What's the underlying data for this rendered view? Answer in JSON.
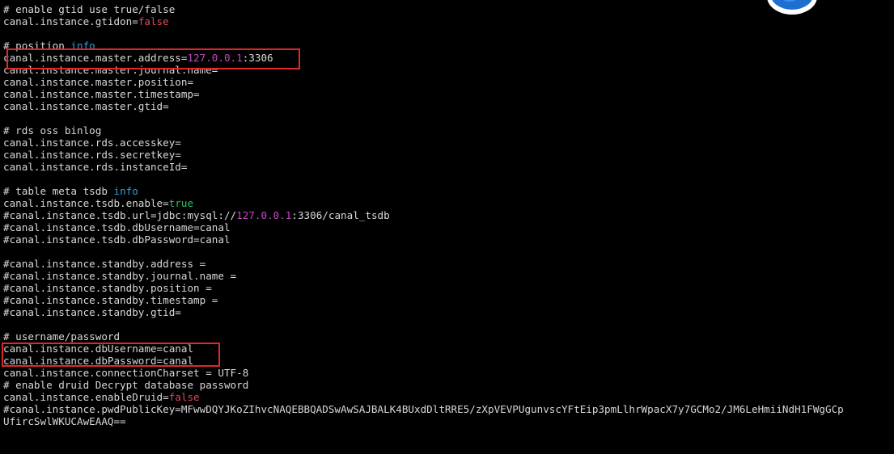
{
  "terminal": {
    "lines": [
      {
        "segments": [
          {
            "text": "# enable gtid use true/false",
            "style": "comment"
          }
        ]
      },
      {
        "segments": [
          {
            "text": "canal.instance.gtidon=",
            "style": "plain"
          },
          {
            "text": "false",
            "style": "bool-false"
          }
        ]
      },
      {
        "segments": [
          {
            "text": "",
            "style": "plain"
          }
        ]
      },
      {
        "segments": [
          {
            "text": "# position ",
            "style": "comment"
          },
          {
            "text": "info",
            "style": "info"
          }
        ]
      },
      {
        "segments": [
          {
            "text": "canal.instance.master.address=",
            "style": "plain"
          },
          {
            "text": "127.0.0.1",
            "style": "ip"
          },
          {
            "text": ":3306",
            "style": "plain"
          }
        ]
      },
      {
        "segments": [
          {
            "text": "canal.instance.master.journal.name=",
            "style": "plain"
          }
        ]
      },
      {
        "segments": [
          {
            "text": "canal.instance.master.position=",
            "style": "plain"
          }
        ]
      },
      {
        "segments": [
          {
            "text": "canal.instance.master.timestamp=",
            "style": "plain"
          }
        ]
      },
      {
        "segments": [
          {
            "text": "canal.instance.master.gtid=",
            "style": "plain"
          }
        ]
      },
      {
        "segments": [
          {
            "text": "",
            "style": "plain"
          }
        ]
      },
      {
        "segments": [
          {
            "text": "# rds oss binlog",
            "style": "comment"
          }
        ]
      },
      {
        "segments": [
          {
            "text": "canal.instance.rds.accesskey=",
            "style": "plain"
          }
        ]
      },
      {
        "segments": [
          {
            "text": "canal.instance.rds.secretkey=",
            "style": "plain"
          }
        ]
      },
      {
        "segments": [
          {
            "text": "canal.instance.rds.instanceId=",
            "style": "plain"
          }
        ]
      },
      {
        "segments": [
          {
            "text": "",
            "style": "plain"
          }
        ]
      },
      {
        "segments": [
          {
            "text": "# table meta tsdb ",
            "style": "comment"
          },
          {
            "text": "info",
            "style": "info"
          }
        ]
      },
      {
        "segments": [
          {
            "text": "canal.instance.tsdb.enable=",
            "style": "plain"
          },
          {
            "text": "true",
            "style": "bool-true"
          }
        ]
      },
      {
        "segments": [
          {
            "text": "#canal.instance.tsdb.url=jdbc:mysql://",
            "style": "plain"
          },
          {
            "text": "127.0.0.1",
            "style": "ip"
          },
          {
            "text": ":3306/canal_tsdb",
            "style": "plain"
          }
        ]
      },
      {
        "segments": [
          {
            "text": "#canal.instance.tsdb.dbUsername=canal",
            "style": "plain"
          }
        ]
      },
      {
        "segments": [
          {
            "text": "#canal.instance.tsdb.dbPassword=canal",
            "style": "plain"
          }
        ]
      },
      {
        "segments": [
          {
            "text": "",
            "style": "plain"
          }
        ]
      },
      {
        "segments": [
          {
            "text": "#canal.instance.standby.address =",
            "style": "plain"
          }
        ]
      },
      {
        "segments": [
          {
            "text": "#canal.instance.standby.journal.name =",
            "style": "plain"
          }
        ]
      },
      {
        "segments": [
          {
            "text": "#canal.instance.standby.position =",
            "style": "plain"
          }
        ]
      },
      {
        "segments": [
          {
            "text": "#canal.instance.standby.timestamp =",
            "style": "plain"
          }
        ]
      },
      {
        "segments": [
          {
            "text": "#canal.instance.standby.gtid=",
            "style": "plain"
          }
        ]
      },
      {
        "segments": [
          {
            "text": "",
            "style": "plain"
          }
        ]
      },
      {
        "segments": [
          {
            "text": "# username/password",
            "style": "comment"
          }
        ]
      },
      {
        "segments": [
          {
            "text": "canal.instance.dbUsername=canal",
            "style": "plain"
          }
        ]
      },
      {
        "segments": [
          {
            "text": "canal.instance.dbPassword=canal",
            "style": "plain"
          }
        ]
      },
      {
        "segments": [
          {
            "text": "canal.instance.connectionCharset = UTF-8",
            "style": "plain"
          }
        ]
      },
      {
        "segments": [
          {
            "text": "# enable druid Decrypt database password",
            "style": "comment"
          }
        ]
      },
      {
        "segments": [
          {
            "text": "canal.instance.enableDruid=",
            "style": "plain"
          },
          {
            "text": "false",
            "style": "bool-false"
          }
        ]
      },
      {
        "segments": [
          {
            "text": "#canal.instance.pwdPublicKey=MFwwDQYJKoZIhvcNAQEBBQADSwAwSAJBALK4BUxdDltRRE5/zXpVEVPUgunvscYFtEip3pmLlhrWpacX7y7GCMo2/JM6LeHmiiNdH1FWgGCp",
            "style": "plain"
          }
        ]
      },
      {
        "segments": [
          {
            "text": "UfircSwlWKUCAwEAAQ==",
            "style": "plain"
          }
        ]
      }
    ]
  },
  "highlights": [
    {
      "name": "master-address-highlight"
    },
    {
      "name": "db-credentials-highlight"
    }
  ],
  "colors": {
    "background": "#000000",
    "text": "#d8d8d8",
    "keyword_info": "#2e9fd6",
    "bool_false": "#e0475f",
    "bool_true": "#2ac16a",
    "ip_literal": "#c149c1",
    "highlight_border": "#e02828"
  },
  "icons": {
    "corner_avatar": "avatar-icon"
  }
}
